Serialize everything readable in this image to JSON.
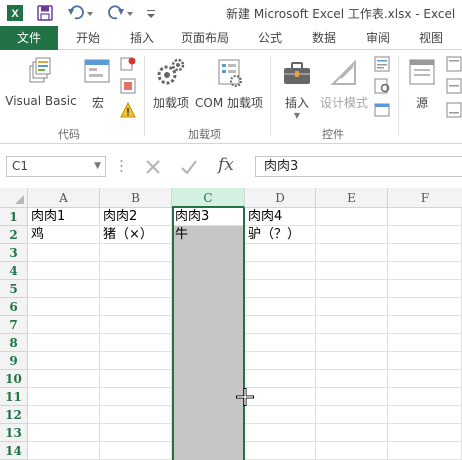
{
  "window": {
    "title": "新建 Microsoft Excel 工作表.xlsx - Excel"
  },
  "quick_access": [
    {
      "icon": "excel-logo-icon"
    },
    {
      "icon": "save-icon"
    },
    {
      "icon": "undo-icon"
    },
    {
      "icon": "redo-icon"
    },
    {
      "icon": "customize-quick-access-icon"
    }
  ],
  "tabs": [
    {
      "label": "文件",
      "active": true
    },
    {
      "label": "开始"
    },
    {
      "label": "插入"
    },
    {
      "label": "页面布局"
    },
    {
      "label": "公式"
    },
    {
      "label": "数据"
    },
    {
      "label": "审阅"
    },
    {
      "label": "视图"
    }
  ],
  "ribbon": {
    "code_group": {
      "label": "代码",
      "visual_basic": "Visual Basic",
      "macros": "宏"
    },
    "addins_group": {
      "label": "加载项",
      "addins": "加载项",
      "com_addins": "COM 加载项"
    },
    "controls_group": {
      "label": "控件",
      "insert": "插入",
      "design_mode": "设计模式"
    },
    "xml_group": {
      "source": "源"
    }
  },
  "formula_bar": {
    "name_box": "C1",
    "fx": "fx",
    "content": "肉肉3"
  },
  "sheet": {
    "columns": [
      "A",
      "B",
      "C",
      "D",
      "E",
      "F"
    ],
    "selected_column": "C",
    "rows": [
      "1",
      "2",
      "3",
      "4",
      "5",
      "6",
      "7",
      "8",
      "9",
      "10",
      "11",
      "12",
      "13",
      "14"
    ],
    "cells": {
      "A1": "肉肉1",
      "B1": "肉肉2",
      "C1": "肉肉3",
      "D1": "肉肉4",
      "A2": "鸡",
      "B2": "猪（×）",
      "C2": "牛",
      "D2": "驴（？）"
    }
  },
  "colors": {
    "accent": "#217346",
    "selection_fill": "#c6c6c6",
    "header_fill": "#f3f3f3"
  }
}
